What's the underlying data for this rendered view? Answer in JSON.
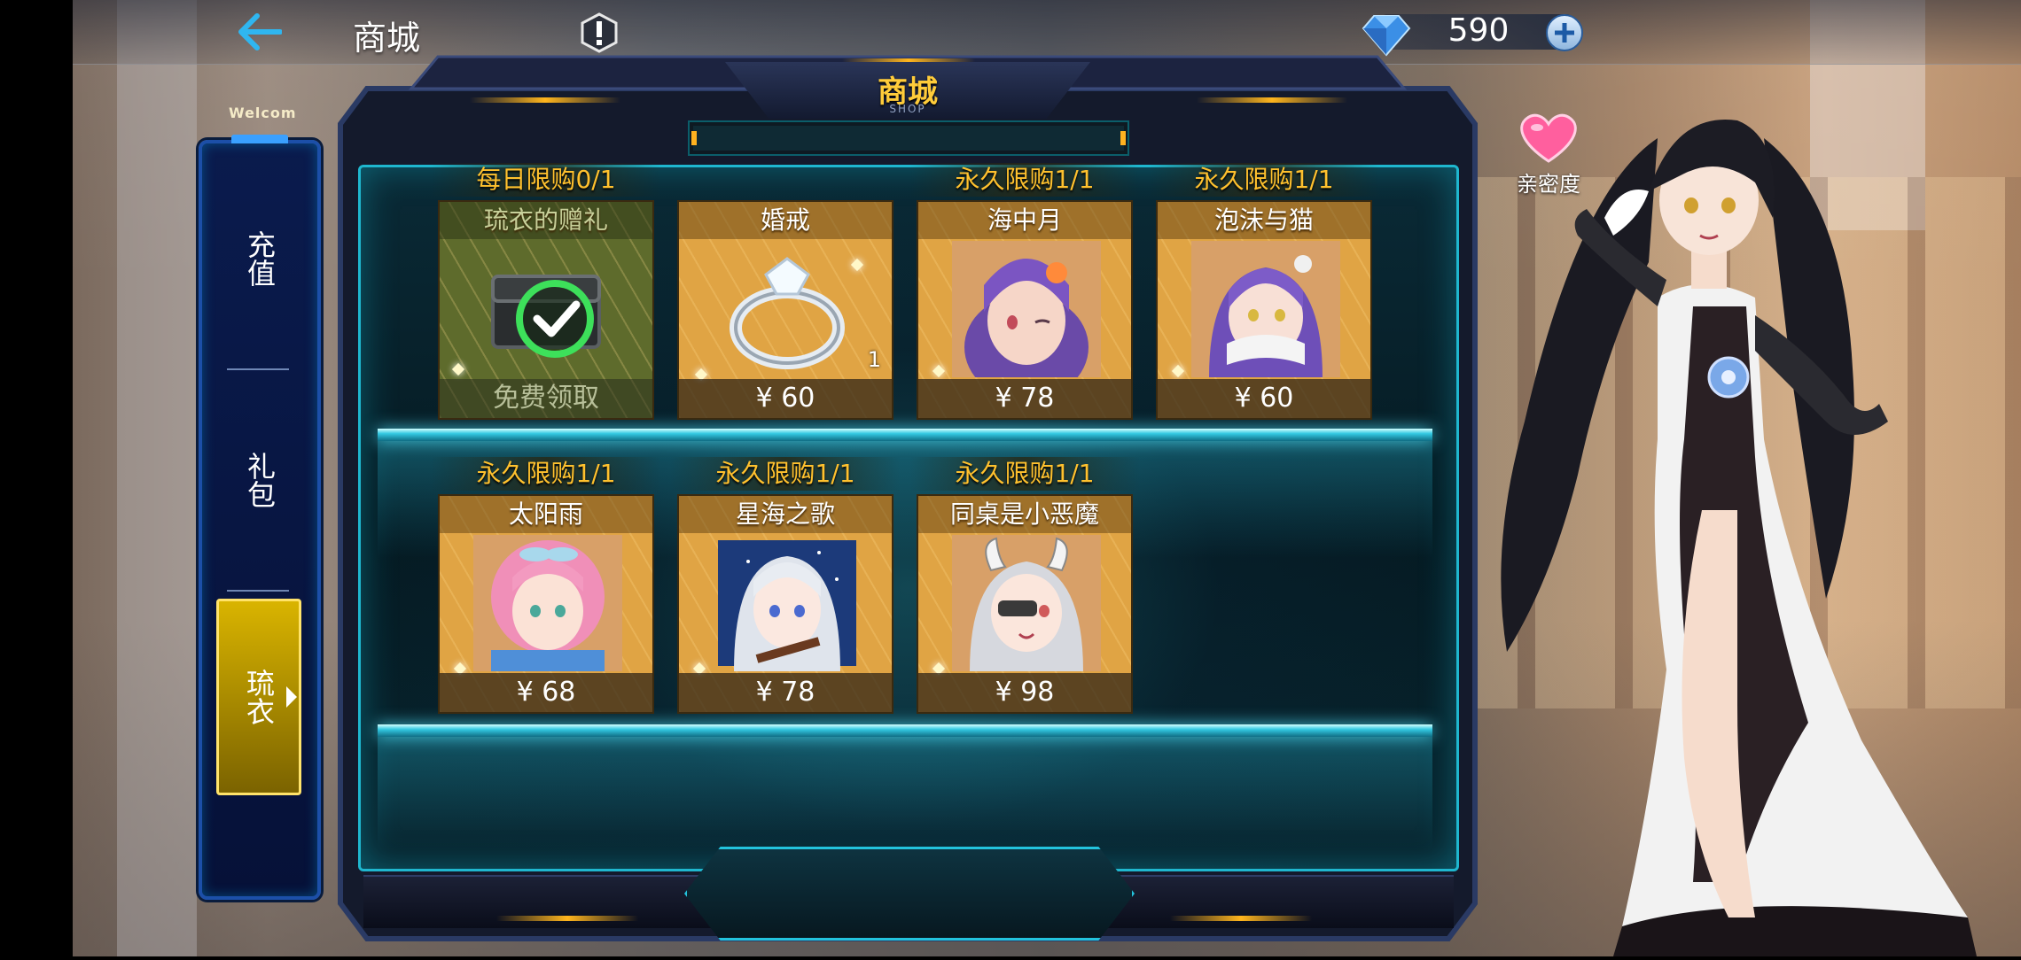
{
  "header": {
    "title": "商城",
    "currency_value": "590"
  },
  "sidebar": {
    "welcome_text": "Welcom",
    "tabs": [
      {
        "label": "充值",
        "selected": false
      },
      {
        "label": "礼包",
        "selected": false
      },
      {
        "label": "琉衣",
        "selected": true
      }
    ]
  },
  "shop": {
    "title": "商城",
    "subtitle": "SHOP",
    "items": [
      {
        "name": "琉衣的赠礼",
        "limit": "每日限购0/1",
        "price": "免费领取",
        "claimed": true,
        "icon": "chest-icon"
      },
      {
        "name": "婚戒",
        "limit": "",
        "price": "¥ 60",
        "quantity": "1",
        "icon": "ring-icon"
      },
      {
        "name": "海中月",
        "limit": "永久限购1/1",
        "price": "¥ 78",
        "icon": "portrait-purple-hair"
      },
      {
        "name": "泡沫与猫",
        "limit": "永久限购1/1",
        "price": "¥ 60",
        "icon": "portrait-purple-hair-scarf"
      },
      {
        "name": "太阳雨",
        "limit": "永久限购1/1",
        "price": "¥ 68",
        "icon": "portrait-pink-hair"
      },
      {
        "name": "星海之歌",
        "limit": "永久限购1/1",
        "price": "¥ 78",
        "icon": "portrait-silver-hair-violin"
      },
      {
        "name": "同桌是小恶魔",
        "limit": "永久限购1/1",
        "price": "¥ 98",
        "icon": "portrait-white-hair-horns"
      }
    ]
  },
  "character_panel": {
    "affection_label": "亲密度",
    "affection_icon": "heart-icon"
  },
  "colors": {
    "accent_gold": "#ffc12e",
    "frame_cyan": "#1fb7cf",
    "card_orange": "#e0a444",
    "tab_selected": "#d9b400"
  }
}
